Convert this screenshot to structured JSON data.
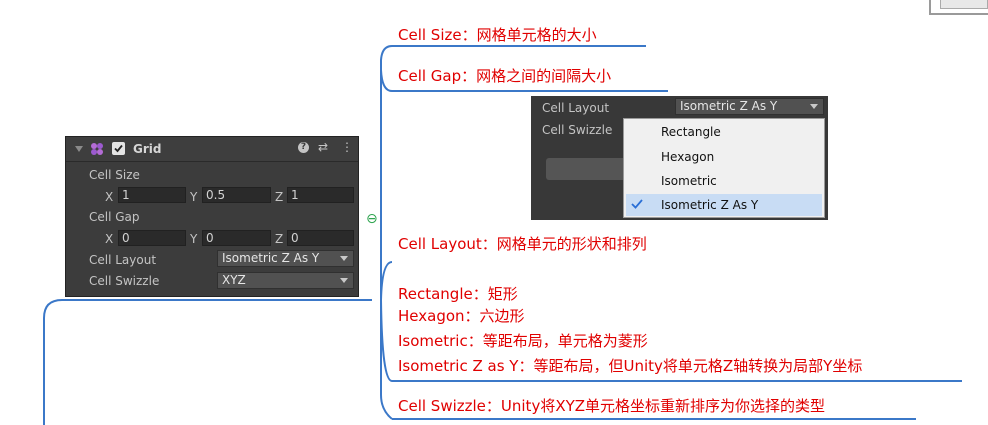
{
  "inspector": {
    "component_title": "Grid",
    "cell_size_label": "Cell Size",
    "cell_size": {
      "x_label": "X",
      "x": "1",
      "y_label": "Y",
      "y": "0.5",
      "z_label": "Z",
      "z": "1"
    },
    "cell_gap_label": "Cell Gap",
    "cell_gap": {
      "x_label": "X",
      "x": "0",
      "y_label": "Y",
      "y": "0",
      "z_label": "Z",
      "z": "0"
    },
    "cell_layout_label": "Cell Layout",
    "cell_layout_value": "Isometric Z As Y",
    "cell_swizzle_label": "Cell Swizzle",
    "cell_swizzle_value": "XYZ"
  },
  "dropdown_shot": {
    "cell_layout_label": "Cell Layout",
    "cell_swizzle_label": "Cell Swizzle",
    "selected": "Isometric Z As Y",
    "options": [
      "Rectangle",
      "Hexagon",
      "Isometric",
      "Isometric Z As Y"
    ],
    "checked_index": 3
  },
  "mindmap": {
    "cell_size": "Cell Size：网格单元格的大小",
    "cell_gap": "Cell Gap：网格之间的间隔大小",
    "cell_layout": "Cell Layout：网格单元的形状和排列",
    "rectangle": "Rectangle：矩形",
    "hexagon": "Hexagon：六边形",
    "isometric": "Isometric：等距布局，单元格为菱形",
    "isometric_z_as_y": "Isometric Z as Y：等距布局，但Unity将单元格Z轴转换为局部Y坐标",
    "cell_swizzle": "Cell Swizzle：Unity将XYZ单元格坐标重新排序为你选择的类型",
    "collapse_symbol": "⊖"
  },
  "colors": {
    "topic_text": "#e00000",
    "branch_line": "#3b78c8",
    "panel_bg": "#3c3c3c",
    "collapse": "#2ea44f"
  }
}
